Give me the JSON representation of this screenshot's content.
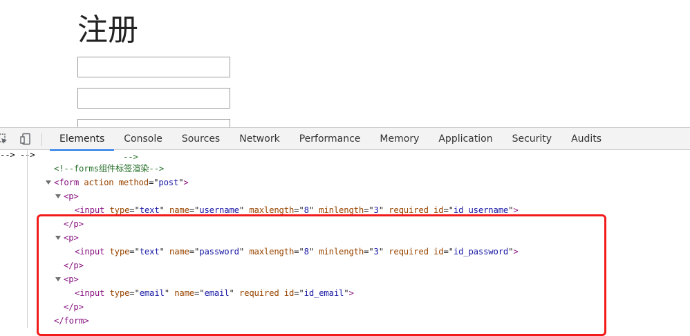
{
  "page": {
    "title": "注册",
    "fields": [
      {
        "value": ""
      },
      {
        "value": ""
      },
      {
        "value": ""
      }
    ]
  },
  "devtools": {
    "tabs": [
      "Elements",
      "Console",
      "Sources",
      "Network",
      "Performance",
      "Memory",
      "Application",
      "Security",
      "Audits"
    ],
    "active_tab": "Elements",
    "code": {
      "comment_end": "-->",
      "comment_forms": "<!--forms组件标签渲染-->",
      "form_open": {
        "tag": "form",
        "attr1": "action",
        "attr2": "method",
        "value2": "post"
      },
      "p_tag": "p",
      "input_tag": "input",
      "inputs": [
        {
          "type": "text",
          "name": "username",
          "maxlength": "8",
          "minlength": "3",
          "required": "required",
          "id": "id_username"
        },
        {
          "type": "text",
          "name": "password",
          "maxlength": "8",
          "minlength": "3",
          "required": "required",
          "id": "id_password"
        },
        {
          "type": "email",
          "name": "email",
          "required": "required",
          "id": "id_email"
        }
      ],
      "form_close": "form"
    }
  },
  "colors": {
    "highlight": "#f21a1a",
    "active_tab_underline": "#1a73e8",
    "tag_name": "#881280",
    "attr_name": "#994500",
    "attr_value": "#1a1aa6",
    "comment": "#236e25"
  }
}
